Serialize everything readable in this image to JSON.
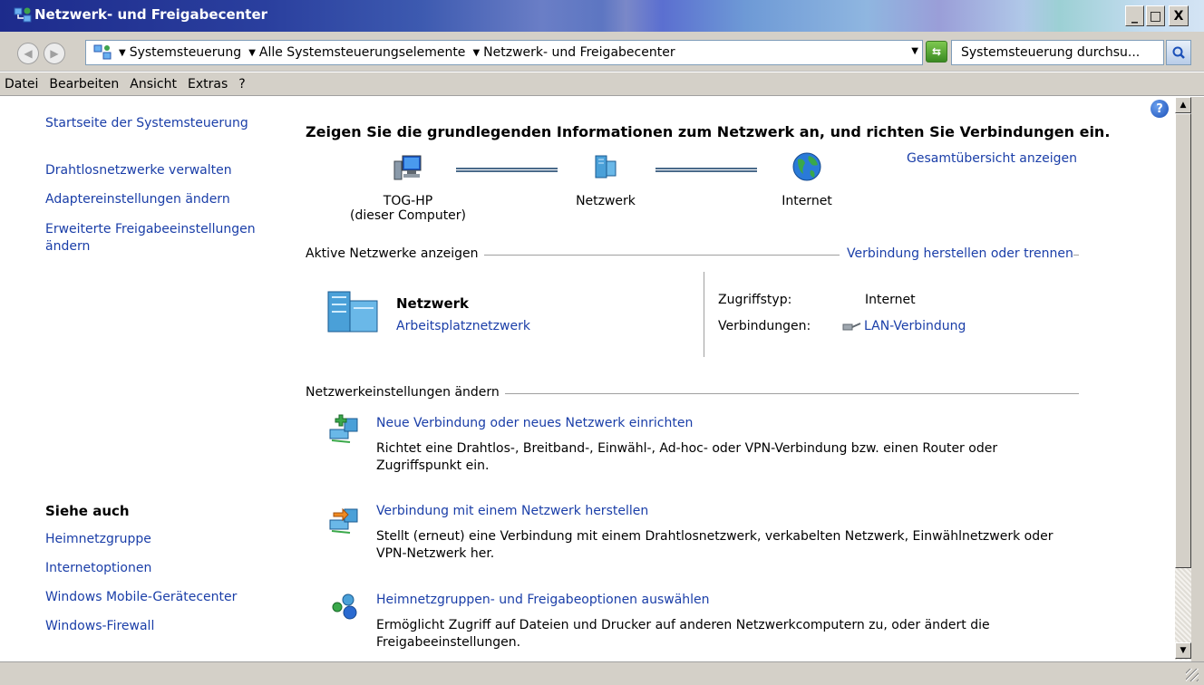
{
  "window": {
    "title": "Netzwerk- und Freigabecenter",
    "min_label": "_",
    "max_label": "□",
    "close_label": "X"
  },
  "address": {
    "crumbs": [
      "Systemsteuerung",
      "Alle Systemsteuerungselemente",
      "Netzwerk- und Freigabecenter"
    ],
    "search_placeholder": "Systemsteuerung durchsu..."
  },
  "menu": [
    "Datei",
    "Bearbeiten",
    "Ansicht",
    "Extras",
    "?"
  ],
  "sidebar": {
    "home": "Startseite der Systemsteuerung",
    "links": [
      "Drahtlosnetzwerke verwalten",
      "Adaptereinstellungen ändern",
      "Erweiterte Freigabeeinstellungen",
      "ändern"
    ],
    "see_also_title": "Siehe auch",
    "see_also": [
      "Heimnetzgruppe",
      "Internetoptionen",
      "Windows Mobile-Gerätecenter",
      "Windows-Firewall"
    ]
  },
  "main": {
    "heading": "Zeigen Sie die grundlegenden Informationen zum Netzwerk an, und richten Sie Verbindungen ein.",
    "overview_link": "Gesamtübersicht anzeigen",
    "nodes": [
      {
        "label": "TOG-HP",
        "sub": "(dieser Computer)",
        "icon": "computer-icon"
      },
      {
        "label": "Netzwerk",
        "sub": "",
        "icon": "network-icon"
      },
      {
        "label": "Internet",
        "sub": "",
        "icon": "globe-icon"
      }
    ],
    "active_label": "Aktive Netzwerke anzeigen",
    "connect_link": "Verbindung herstellen oder trennen",
    "active_network": {
      "name": "Netzwerk",
      "type_link": "Arbeitsplatznetzwerk",
      "access_label": "Zugriffstyp:",
      "access_value": "Internet",
      "conn_label": "Verbindungen:",
      "conn_value": "LAN-Verbindung"
    },
    "settings_label": "Netzwerkeinstellungen ändern",
    "tasks": [
      {
        "title": "Neue Verbindung oder neues Netzwerk einrichten",
        "desc": "Richtet eine Drahtlos-, Breitband-, Einwähl-, Ad-hoc- oder VPN-Verbindung bzw. einen Router oder Zugriffspunkt ein."
      },
      {
        "title": "Verbindung mit einem Netzwerk herstellen",
        "desc": "Stellt (erneut) eine Verbindung mit einem Drahtlosnetzwerk, verkabelten Netzwerk, Einwählnetzwerk oder VPN-Netzwerk her."
      },
      {
        "title": "Heimnetzgruppen- und Freigabeoptionen auswählen",
        "desc": "Ermöglicht Zugriff auf Dateien und Drucker auf anderen Netzwerkcomputern zu, oder ändert die Freigabeeinstellungen."
      }
    ]
  },
  "colors": {
    "link": "#1a3ea8",
    "chrome": "#d4d0c8"
  }
}
